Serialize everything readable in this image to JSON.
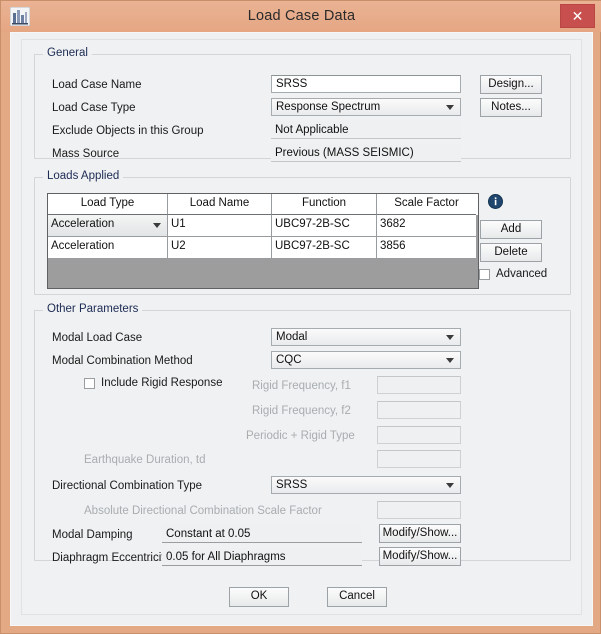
{
  "window": {
    "title": "Load Case Data",
    "app_icon": "etabs-building-icon",
    "close_label": "✕",
    "titlebar_color": "#e7aa86",
    "close_button_color": "#c7504f"
  },
  "general": {
    "section_title": "General",
    "rows": [
      {
        "label": "Load Case Name",
        "value": "SRSS",
        "control": "textbox"
      },
      {
        "label": "Load Case Type",
        "value": "Response Spectrum",
        "control": "combo"
      },
      {
        "label": "Exclude Objects in this Group",
        "value": "Not Applicable",
        "control": "readonly"
      },
      {
        "label": "Mass Source",
        "value": "Previous  (MASS SEISMIC)",
        "control": "readonly"
      }
    ],
    "buttons": [
      {
        "label": "Design..."
      },
      {
        "label": "Notes..."
      }
    ]
  },
  "loads_applied": {
    "section_title": "Loads Applied",
    "columns": [
      "Load Type",
      "Load Name",
      "Function",
      "Scale Factor"
    ],
    "rows": [
      {
        "load_type": "Acceleration",
        "load_name": "U1",
        "function": "UBC97-2B-SC",
        "scale_factor": "3682"
      },
      {
        "load_type": "Acceleration",
        "load_name": "U2",
        "function": "UBC97-2B-SC",
        "scale_factor": "3856"
      }
    ],
    "info_icon": "info-circle-icon",
    "add_label": "Add",
    "delete_label": "Delete",
    "advanced_label": "Advanced",
    "advanced_checked": false
  },
  "other_parameters": {
    "section_title": "Other Parameters",
    "modal_load_case_label": "Modal Load Case",
    "modal_load_case_value": "Modal",
    "modal_combination_label": "Modal Combination Method",
    "modal_combination_value": "CQC",
    "include_rigid_response_label": "Include Rigid Response",
    "include_rigid_response_checked": false,
    "rigid_frequency_f1_label": "Rigid Frequency, f1",
    "rigid_frequency_f1_value": "",
    "rigid_frequency_f2_label": "Rigid Frequency, f2",
    "rigid_frequency_f2_value": "",
    "periodic_rigid_type_label": "Periodic + Rigid Type",
    "periodic_rigid_type_value": "",
    "earthquake_duration_label": "Earthquake Duration, td",
    "earthquake_duration_value": "",
    "directional_combination_label": "Directional Combination Type",
    "directional_combination_value": "SRSS",
    "absolute_scale_factor_label": "Absolute Directional Combination Scale Factor",
    "absolute_scale_factor_value": "",
    "modal_damping_label": "Modal Damping",
    "modal_damping_value": "Constant at 0.05",
    "modal_damping_button": "Modify/Show...",
    "diaphragm_eccentricity_label": "Diaphragm Eccentricity",
    "diaphragm_eccentricity_value": "0.05 for All Diaphragms",
    "diaphragm_eccentricity_button": "Modify/Show..."
  },
  "footer": {
    "ok_label": "OK",
    "cancel_label": "Cancel"
  }
}
